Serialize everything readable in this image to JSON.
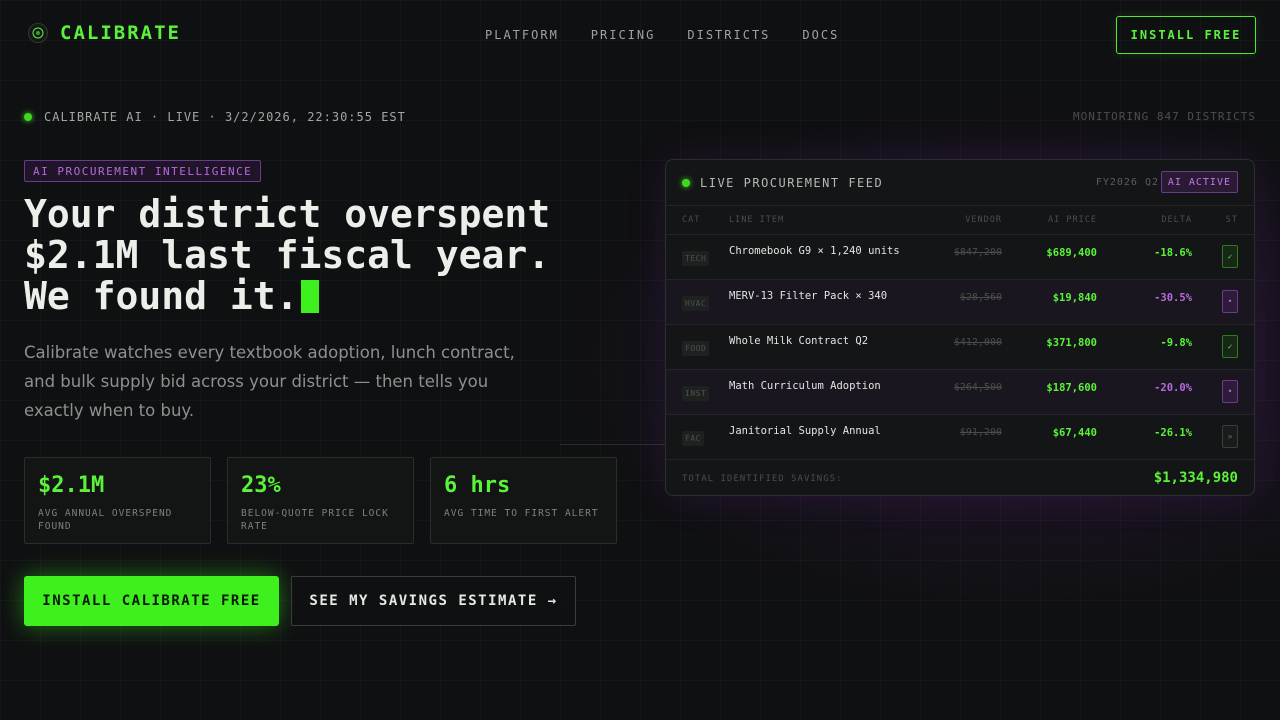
{
  "nav": {
    "brand": "CALIBRATE",
    "links": [
      "PLATFORM",
      "PRICING",
      "DISTRICTS",
      "DOCS"
    ],
    "cta": "INSTALL FREE"
  },
  "status": {
    "text": "CALIBRATE AI · LIVE · 3/2/2026, 22:30:55 EST",
    "monitoring": "MONITORING 847 DISTRICTS"
  },
  "hero": {
    "tag": "AI PROCUREMENT INTELLIGENCE",
    "headline_lines": [
      "Your district overspent",
      "$2.1M last fiscal year.",
      "We found it."
    ],
    "subtext": "Calibrate watches every textbook adoption, lunch contract, and bulk supply bid across your district — then tells you exactly when to buy."
  },
  "stats": [
    {
      "value": "$2.1M",
      "label": "AVG ANNUAL OVERSPEND FOUND"
    },
    {
      "value": "23%",
      "label": "BELOW-QUOTE PRICE LOCK RATE"
    },
    {
      "value": "6 hrs",
      "label": "AVG TIME TO FIRST ALERT"
    }
  ],
  "ctas": {
    "primary": "INSTALL CALIBRATE FREE",
    "secondary": "SEE MY SAVINGS ESTIMATE →"
  },
  "feed": {
    "title": "LIVE PROCUREMENT FEED",
    "period": "FY2026 Q2",
    "badge": "AI ACTIVE",
    "columns": {
      "cat": "CAT",
      "item": "LINE ITEM",
      "vendor": "VENDOR",
      "price": "AI PRICE",
      "delta": "DELTA",
      "st": "ST"
    },
    "rows": [
      {
        "cat": "TECH",
        "item": "Chromebook G9 × 1,240 units",
        "vendor": "$847,200",
        "price": "$689,400",
        "delta": "-18.6%",
        "delta_tone": "green",
        "status": "ok",
        "status_glyph": "✓"
      },
      {
        "cat": "HVAC",
        "item": "MERV-13 Filter Pack × 340",
        "vendor": "$28,560",
        "price": "$19,840",
        "delta": "-30.5%",
        "delta_tone": "purple",
        "status": "pend",
        "status_glyph": "•"
      },
      {
        "cat": "FOOD",
        "item": "Whole Milk Contract Q2",
        "vendor": "$412,000",
        "price": "$371,800",
        "delta": "-9.8%",
        "delta_tone": "green",
        "status": "ok",
        "status_glyph": "✓"
      },
      {
        "cat": "INST",
        "item": "Math Curriculum Adoption",
        "vendor": "$264,500",
        "price": "$187,600",
        "delta": "-20.0%",
        "delta_tone": "purple",
        "status": "pend",
        "status_glyph": "•"
      },
      {
        "cat": "FAC",
        "item": "Janitorial Supply Annual",
        "vendor": "$91,200",
        "price": "$67,440",
        "delta": "-26.1%",
        "delta_tone": "green",
        "status": "idle",
        "status_glyph": "»"
      }
    ],
    "total_label": "TOTAL IDENTIFIED SAVINGS:",
    "total_value": "$1,334,980"
  },
  "colors": {
    "accent": "#3ef01e",
    "purple": "#b56be0",
    "background": "#0f1012"
  }
}
